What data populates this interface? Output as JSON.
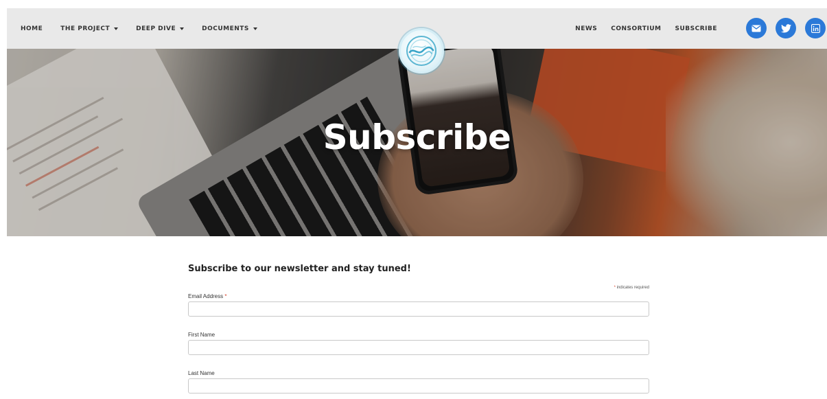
{
  "nav": {
    "left_items": [
      {
        "label": "HOME",
        "dropdown": false
      },
      {
        "label": "THE PROJECT",
        "dropdown": true
      },
      {
        "label": "DEEP DIVE",
        "dropdown": true
      },
      {
        "label": "DOCUMENTS",
        "dropdown": true
      }
    ],
    "right_items": [
      {
        "label": "NEWS"
      },
      {
        "label": "CONSORTIUM"
      },
      {
        "label": "SUBSCRIBE"
      }
    ],
    "social": [
      {
        "icon": "email-icon"
      },
      {
        "icon": "twitter-icon"
      },
      {
        "icon": "linkedin-icon"
      }
    ]
  },
  "hero": {
    "title": "Subscribe"
  },
  "form": {
    "heading": "Subscribe to our newsletter and stay tuned!",
    "required_star": "*",
    "required_note": "indicates required",
    "fields": [
      {
        "label": "Email Address",
        "required": "*",
        "value": "",
        "placeholder": ""
      },
      {
        "label": "First Name",
        "value": "",
        "placeholder": ""
      },
      {
        "label": "Last Name",
        "value": "",
        "placeholder": ""
      }
    ]
  },
  "colors": {
    "nav_bg": "#e9e9e9",
    "social_blue": "#2b79d8",
    "required_red": "#d9442b"
  }
}
